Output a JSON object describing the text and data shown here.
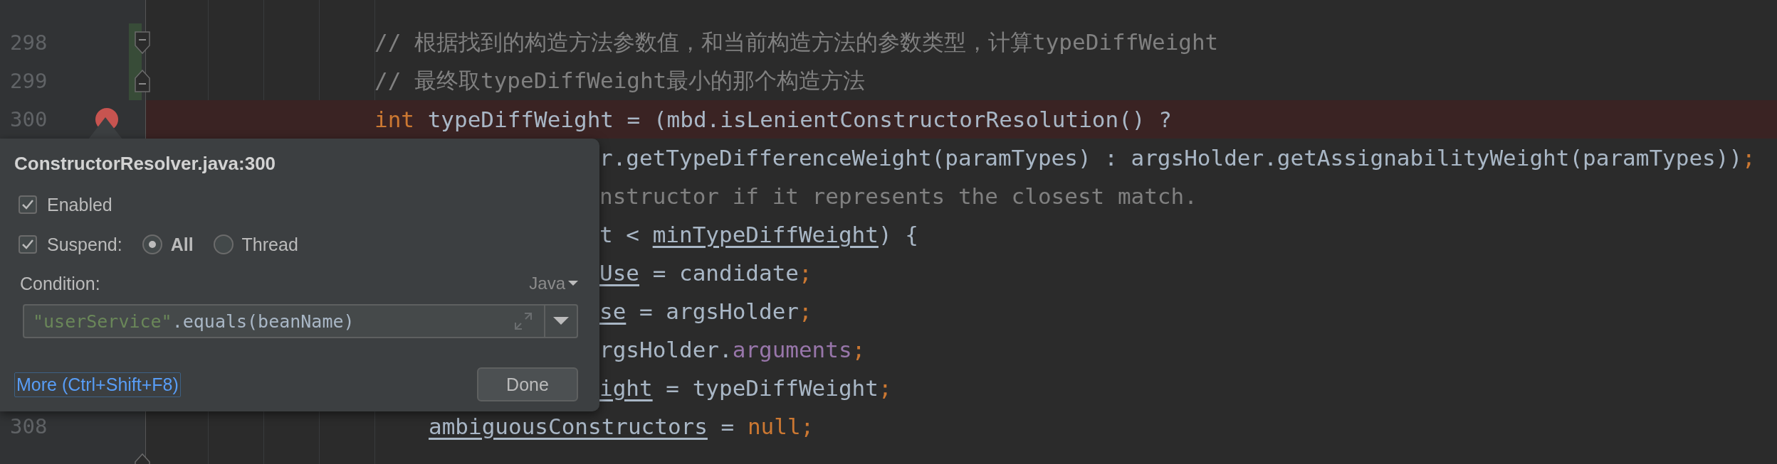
{
  "editor": {
    "lines": [
      {
        "kind": "normal",
        "changed": false,
        "breakpoint": false
      },
      {
        "number": "298",
        "kind": "normal",
        "changed": true,
        "breakpoint": false,
        "fold": {
          "kind": "start"
        },
        "segments": [
          {
            "text": "// 根据找到的构造方法参数值，和当前构造方法的参数类型，计算typeDiffWeight",
            "kind": "comment"
          }
        ]
      },
      {
        "number": "299",
        "kind": "normal",
        "changed": true,
        "breakpoint": false,
        "fold": {
          "kind": "end"
        },
        "segments": [
          {
            "text": "// 最终取typeDiffWeight最小的那个构造方法",
            "kind": "comment"
          }
        ]
      },
      {
        "number": "300",
        "kind": "normal",
        "changed": false,
        "breakpoint": true,
        "segments": [
          {
            "text": "int",
            "kind": "keyword"
          },
          {
            "text": " typeDiffWeight = (mbd.isLenientConstructorResolution() ?",
            "kind": "plain"
          }
        ]
      },
      {
        "kind": "clipped",
        "breakpoint": false,
        "segments": [
          {
            "text": "r.getTypeDifferenceWeight(paramTypes) : argsHolder.getAssignabilityWeight(paramTypes))",
            "kind": "plain"
          },
          {
            "text": ";",
            "kind": "keyword"
          }
        ]
      },
      {
        "kind": "clipped",
        "breakpoint": false,
        "segments": [
          {
            "text": "nstructor if it represents the closest match.",
            "kind": "comment"
          }
        ]
      },
      {
        "kind": "clipped",
        "breakpoint": false,
        "segments": [
          {
            "text": "t < ",
            "kind": "plain"
          },
          {
            "text": "minTypeDiffWeight",
            "kind": "underlined"
          },
          {
            "text": ") {",
            "kind": "plain"
          }
        ]
      },
      {
        "kind": "clipped",
        "breakpoint": false,
        "segments": [
          {
            "text": "Use",
            "kind": "underlined"
          },
          {
            "text": " = candidate",
            "kind": "plain"
          },
          {
            "text": ";",
            "kind": "keyword"
          }
        ]
      },
      {
        "kind": "clipped",
        "breakpoint": false,
        "segments": [
          {
            "text": "se",
            "kind": "underlined"
          },
          {
            "text": " = argsHolder",
            "kind": "plain"
          },
          {
            "text": ";",
            "kind": "keyword"
          }
        ]
      },
      {
        "kind": "clipped",
        "breakpoint": false,
        "segments": [
          {
            "text": "rgsHolder.",
            "kind": "plain"
          },
          {
            "text": "arguments",
            "kind": "field"
          },
          {
            "text": ";",
            "kind": "keyword"
          }
        ]
      },
      {
        "kind": "clipped",
        "breakpoint": false,
        "segments": [
          {
            "text": "ight",
            "kind": "underlined"
          },
          {
            "text": " = typeDiffWeight",
            "kind": "plain"
          },
          {
            "text": ";",
            "kind": "keyword"
          }
        ]
      },
      {
        "number": "308",
        "kind": "inner",
        "changed": false,
        "breakpoint": false,
        "segments": [
          {
            "text": "ambiguousConstructors",
            "kind": "underlined"
          },
          {
            "text": " = ",
            "kind": "plain"
          },
          {
            "text": "null",
            "kind": "keyword"
          },
          {
            "text": ";",
            "kind": "keyword"
          }
        ]
      },
      {
        "kind": "normal",
        "changed": false,
        "breakpoint": false,
        "fold": {
          "kind": "end"
        }
      }
    ]
  },
  "breakpoint_popup": {
    "title": "ConstructorResolver.java:300",
    "enabled": {
      "label": "Enabled",
      "checked": true
    },
    "suspend": {
      "label": "Suspend:",
      "checked": true,
      "options": [
        {
          "label": "All",
          "selected": true
        },
        {
          "label": "Thread",
          "selected": false
        }
      ]
    },
    "condition": {
      "label": "Condition:",
      "language": "Java",
      "segments": [
        {
          "text": "\"userService\"",
          "kind": "string"
        },
        {
          "text": ".equals(beanName)",
          "kind": "plain"
        }
      ]
    },
    "more_link": "More (Ctrl+Shift+F8)",
    "done_button": "Done"
  }
}
